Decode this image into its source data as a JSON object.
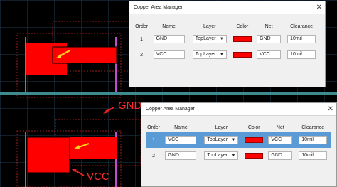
{
  "canvas": {
    "labels": {
      "gnd": "GND",
      "vcc": "VCC"
    },
    "colors": {
      "copper": "#ff0000",
      "arrow": "#ffd21a",
      "outline": "#c14bcf",
      "dashed": "#9a1b1b",
      "grid": "#1f3b55",
      "background": "#000000",
      "divider": "#3f8a8f"
    }
  },
  "dialog_top": {
    "title": "Copper Area Manager",
    "columns": [
      "Order",
      "Name",
      "Layer",
      "Color",
      "Net",
      "Clearance"
    ],
    "rows": [
      {
        "order": "1",
        "name": "GND",
        "layer": "TopLayer",
        "color": "#ff0000",
        "net": "GND",
        "clearance": "10mil",
        "selected": false
      },
      {
        "order": "2",
        "name": "VCC",
        "layer": "TopLayer",
        "color": "#ff0000",
        "net": "VCC",
        "clearance": "10mil",
        "selected": false
      }
    ]
  },
  "dialog_bottom": {
    "title": "Copper Area Manager",
    "columns": [
      "Order",
      "Name",
      "Layer",
      "Color",
      "Net",
      "Clearance"
    ],
    "rows": [
      {
        "order": "1",
        "name": "VCC",
        "layer": "TopLayer",
        "color": "#ff0000",
        "net": "VCC",
        "clearance": "10mil",
        "selected": true
      },
      {
        "order": "2",
        "name": "GND",
        "layer": "TopLayer",
        "color": "#ff0000",
        "net": "GND",
        "clearance": "10mil",
        "selected": false
      }
    ]
  },
  "icons": {
    "close": "close-icon",
    "dropdown": "chevron-down-icon",
    "annotation_arrow": "arrow-icon"
  }
}
